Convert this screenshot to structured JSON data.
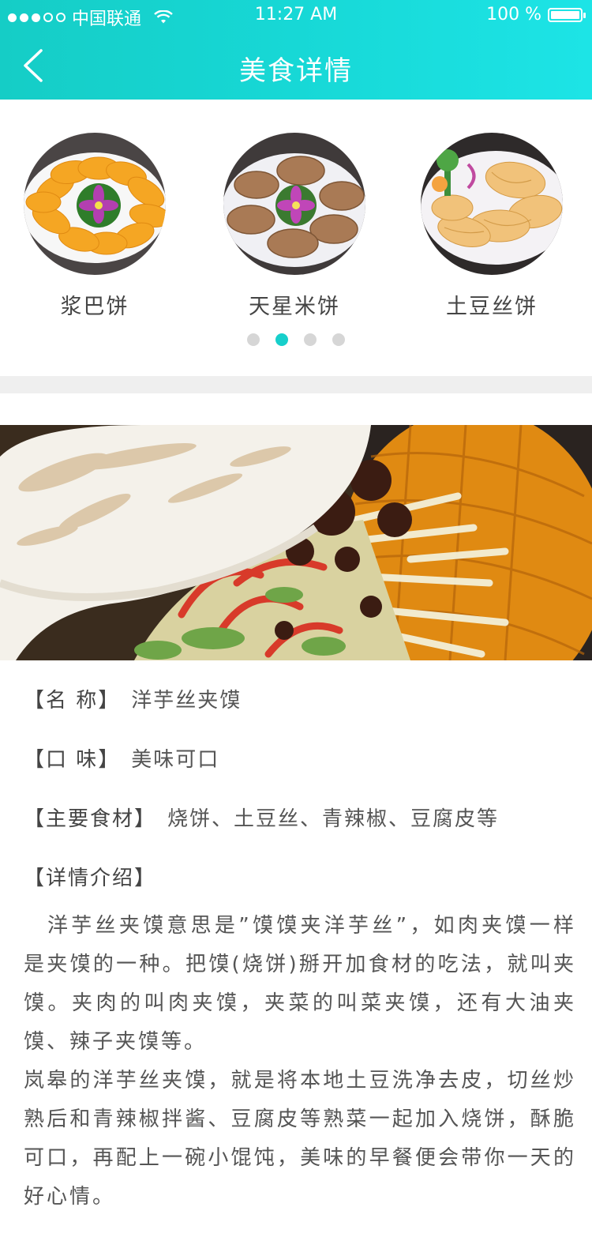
{
  "status_bar": {
    "carrier": "中国联通",
    "time": "11:27 AM",
    "battery": "100 %"
  },
  "header": {
    "title": "美食详情",
    "back_icon": "back-chevron-icon"
  },
  "carousel": {
    "items": [
      {
        "name": "浆巴饼"
      },
      {
        "name": "天星米饼"
      },
      {
        "name": "土豆丝饼"
      }
    ],
    "page_count": 4,
    "active_index": 1
  },
  "details": {
    "name_label": "【名 称】",
    "name_value": "洋芋丝夹馍",
    "taste_label": "【口 味】",
    "taste_value": "美味可口",
    "ingredients_label": "【主要食材】",
    "ingredients_value": "烧饼、土豆丝、青辣椒、豆腐皮等",
    "intro_label": "【详情介绍】",
    "intro_paragraph_1": "洋芋丝夹馍意思是”馍馍夹洋芋丝”，如肉夹馍一样是夹馍的一种。把馍(烧饼)掰开加食材的吃法，就叫夹馍。夹肉的叫肉夹馍，夹菜的叫菜夹馍，还有大油夹馍、辣子夹馍等。",
    "intro_paragraph_2": "岚皋的洋芋丝夹馍，就是将本地土豆洗净去皮，切丝炒熟后和青辣椒拌酱、豆腐皮等熟菜一起加入烧饼，酥脆可口，再配上一碗小馄饨，美味的早餐便会带你一天的好心情。"
  },
  "colors": {
    "accent": "#17cfcb",
    "header_gradient_start": "#15cdc6",
    "header_gradient_end": "#1de4e6"
  }
}
